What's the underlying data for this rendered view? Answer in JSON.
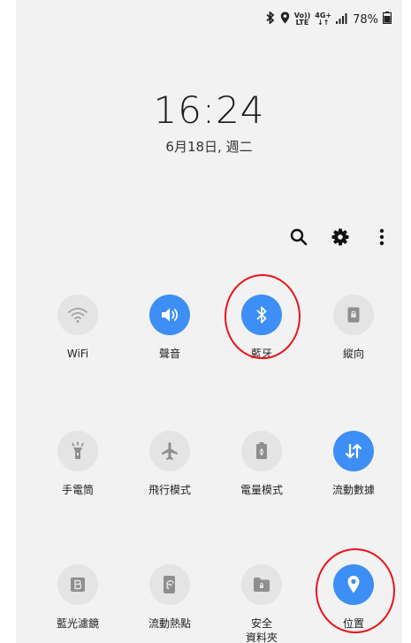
{
  "status_bar": {
    "volte_top": "Vo))",
    "volte_bottom": "LTE",
    "network_top": "4G+",
    "network_bottom": "↓↑",
    "battery_percent": "78%"
  },
  "lock": {
    "time": "16:24",
    "date": "6月18日, 週二"
  },
  "toolbar": {
    "icons": [
      "search-icon",
      "gear-icon",
      "more-vertical-icon"
    ]
  },
  "tiles": [
    {
      "label": "WiFi",
      "icon": "wifi-icon",
      "on": false
    },
    {
      "label": "聲音",
      "icon": "speaker-icon",
      "on": true
    },
    {
      "label": "藍牙",
      "icon": "bluetooth-icon",
      "on": true
    },
    {
      "label": "縱向",
      "icon": "portrait-lock-icon",
      "on": false
    },
    {
      "label": "手電筒",
      "icon": "flashlight-icon",
      "on": false
    },
    {
      "label": "飛行模式",
      "icon": "airplane-icon",
      "on": false
    },
    {
      "label": "電量模式",
      "icon": "battery-saver-icon",
      "on": false
    },
    {
      "label": "流動數據",
      "icon": "mobile-data-icon",
      "on": true
    },
    {
      "label": "藍光濾鏡",
      "icon": "blue-light-filter-icon",
      "on": false
    },
    {
      "label": "流動熱點",
      "icon": "hotspot-icon",
      "on": false
    },
    {
      "label": "安全\n資料夾",
      "icon": "secure-folder-icon",
      "on": false
    },
    {
      "label": "位置",
      "icon": "location-icon",
      "on": true
    }
  ],
  "colors": {
    "active_tile": "#3d8ef5",
    "inactive_tile": "#e4e4e4",
    "annotation_ring": "#e8141c"
  }
}
